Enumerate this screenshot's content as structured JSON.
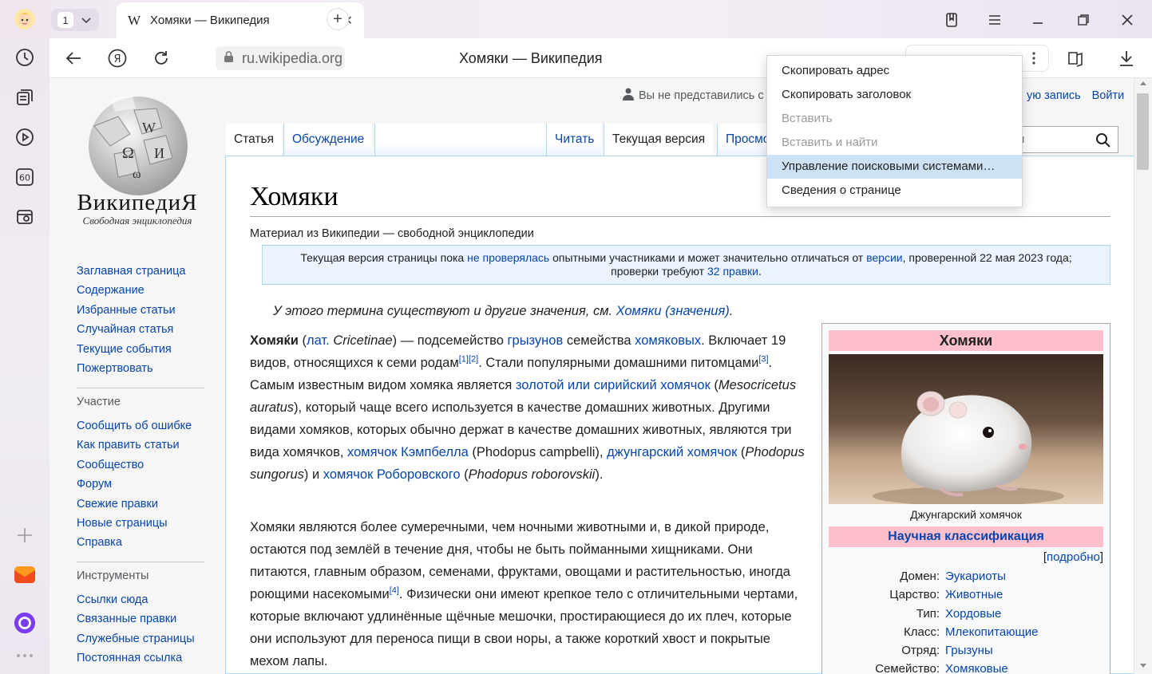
{
  "browser": {
    "tab_count": "1",
    "tab": {
      "favicon": "W",
      "title": "Хомяки — Википедия"
    },
    "address": "ru.wikipedia.org",
    "page_title": "Хомяки — Википедия",
    "side_counter": "60",
    "sidebar_icons": [
      "avatar-icon",
      "history-icon",
      "collections-icon",
      "play-icon",
      "counter-icon",
      "screenshot-icon",
      "add-icon",
      "mail-icon",
      "alice-icon",
      "more-icon"
    ]
  },
  "context_menu": {
    "items": [
      {
        "label": "Скопировать адрес",
        "state": "enabled"
      },
      {
        "label": "Скопировать заголовок",
        "state": "enabled"
      },
      {
        "label": "Вставить",
        "state": "disabled"
      },
      {
        "label": "Вставить и найти",
        "state": "disabled"
      },
      {
        "label": "Управление поисковыми системами…",
        "state": "highlighted"
      },
      {
        "label": "Сведения о странице",
        "state": "enabled"
      }
    ]
  },
  "wiki": {
    "logo_name": "ВикипедиЯ",
    "logo_sub": "Свободная энциклопедия",
    "personal": {
      "not_logged": "Вы не представились с",
      "create": "ую запись",
      "login": "Войти"
    },
    "search_placeholder": "м",
    "tabs": {
      "article": "Статья",
      "talk": "Обсуждение",
      "read": "Читать",
      "current": "Текущая версия",
      "history": "Просмо"
    },
    "nav_main": [
      "Заглавная страница",
      "Содержание",
      "Избранные статьи",
      "Случайная статья",
      "Текущие события",
      "Пожертвовать"
    ],
    "nav_participate_head": "Участие",
    "nav_participate": [
      "Сообщить об ошибке",
      "Как править статьи",
      "Сообщество",
      "Форум",
      "Свежие правки",
      "Новые страницы",
      "Справка"
    ],
    "nav_tools_head": "Инструменты",
    "nav_tools": [
      "Ссылки сюда",
      "Связанные правки",
      "Служебные страницы",
      "Постоянная ссылка"
    ],
    "heading": "Хомяки",
    "site_sub": "Материал из Википедии — свободной энциклопедии",
    "flag": {
      "t1": "Текущая версия страницы пока ",
      "l1": "не проверялась",
      "t2": " опытными участниками и может значительно отличаться от ",
      "l2": "версии",
      "t3": ", проверенной 22 мая 2023 года;",
      "t4": "проверки требуют ",
      "l3": "32 правки",
      "t5": "."
    },
    "hatnote": {
      "text": "У этого термина существуют и другие значения, см. ",
      "link": "Хомяки (значения)",
      "end": "."
    },
    "infobox": {
      "title": "Хомяки",
      "caption": "Джунгарский хомячок",
      "classification": "Научная классификация",
      "more": "подробно",
      "rows": [
        {
          "k": "Домен:",
          "v": "Эукариоты"
        },
        {
          "k": "Царство:",
          "v": "Животные"
        },
        {
          "k": "Тип:",
          "v": "Хордовые"
        },
        {
          "k": "Класс:",
          "v": "Млекопитающие"
        },
        {
          "k": "Отряд:",
          "v": "Грызуны"
        },
        {
          "k": "Семейство:",
          "v": "Хомяковые"
        }
      ]
    },
    "p1": {
      "b": "Хомяќи",
      "a": " (",
      "lat": "лат.",
      "sp": " ",
      "latname": "Cricetinae",
      "c": ") — подсемейство ",
      "l1": "грызунов",
      "d": " семейства ",
      "l2": "хомяковых",
      "e": ". Включает 19 видов, относящихся к семи родам",
      "r1": "[1]",
      "r2": "[2]",
      "f": ". Стали популярными домашними питомцами",
      "r3": "[3]",
      "g": ". Самым известным видом хомяка является ",
      "l3": "золотой или сирийский хомячок",
      "h": " (",
      "sci1": "Mesocricetus auratus",
      "i": "), который чаще всего используется в качестве домашних животных. Другими видами хомяков, которых обычно держат в качестве домашних животных, являются три вида хомячков, ",
      "l4": "хомячок Кэмпбелла",
      "j": " (Phodopus campbelli), ",
      "l5": "джунгарский хомячок",
      "k": " (",
      "sci2": "Phodopus sungorus",
      "m": ") и ",
      "l6": "хомячок Роборовского",
      "n": " (",
      "sci3": "Phodopus roborovskii",
      "o": ")."
    },
    "p2": {
      "a": "Хомяки являются более сумеречными, чем ночными животными и, в дикой природе, остаются под землёй в течение дня, чтобы не быть пойманными хищниками. Они питаются, главным образом, семенами, фруктами, овощами и растительностью, иногда роющими насекомыми",
      "r4": "[4]",
      "b": ". Физически они имеют крепкое тело с отличительными чертами, которые включают удлинённые щёчные мешочки, простирающиеся до их плеч, которые они используют для переноса пищи в свои норы, а также короткий хвост и покрытые мехом лапы."
    }
  }
}
